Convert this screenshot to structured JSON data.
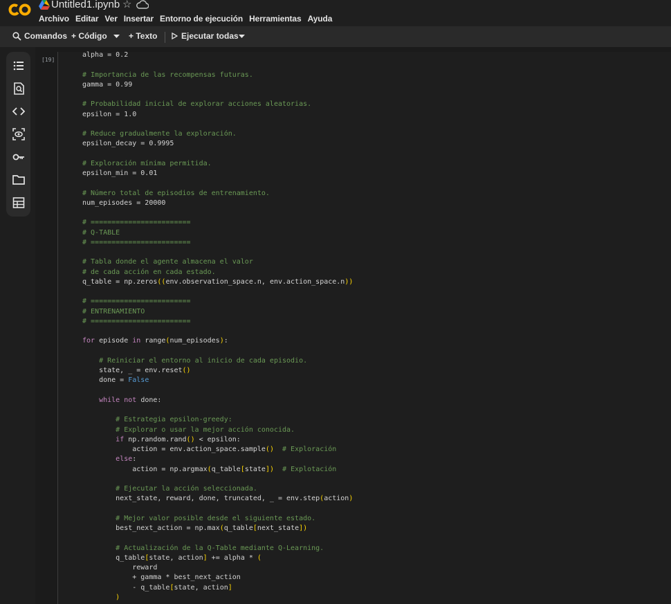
{
  "header": {
    "logo": "CO",
    "title": "Untitled1.ipynb",
    "star_icon": "star-icon",
    "cloud_icon": "cloud-icon"
  },
  "menu": [
    "Archivo",
    "Editar",
    "Ver",
    "Insertar",
    "Entorno de ejecución",
    "Herramientas",
    "Ayuda"
  ],
  "toolbar": {
    "commands": "Comandos",
    "code": "+ Código",
    "text": "+ Texto",
    "run_all": "Ejecutar todas"
  },
  "sidebar_icons": [
    "list-icon",
    "search-doc-icon",
    "code-icon",
    "variables-icon",
    "key-icon",
    "folder-icon",
    "table-icon"
  ],
  "cell": {
    "number": "[19]"
  },
  "colors": {
    "comment": "#6a9955",
    "keyword": "#c586c0",
    "bool": "#569cd6",
    "paren": "#ffd700"
  },
  "code_lines": [
    "alpha = 0.2",
    "",
    "# Importancia de las recompensas futuras.",
    "gamma = 0.99",
    "",
    "# Probabilidad inicial de explorar acciones aleatorias.",
    "epsilon = 1.0",
    "",
    "# Reduce gradualmente la exploración.",
    "epsilon_decay = 0.9995",
    "",
    "# Exploración mínima permitida.",
    "epsilon_min = 0.01",
    "",
    "# Número total de episodios de entrenamiento.",
    "num_episodes = 20000",
    "",
    "# ========================",
    "# Q-TABLE",
    "# ========================",
    "",
    "# Tabla donde el agente almacena el valor",
    "# de cada acción en cada estado.",
    "q_table = np.zeros((env.observation_space.n, env.action_space.n))",
    "",
    "# ========================",
    "# ENTRENAMIENTO",
    "# ========================",
    "",
    "for episode in range(num_episodes):",
    "",
    "    # Reiniciar el entorno al inicio de cada episodio.",
    "    state, _ = env.reset()",
    "    done = False",
    "",
    "    while not done:",
    "",
    "        # Estrategia epsilon-greedy:",
    "        # Explorar o usar la mejor acción conocida.",
    "        if np.random.rand() < epsilon:",
    "            action = env.action_space.sample()  # Exploración",
    "        else:",
    "            action = np.argmax(q_table[state])  # Explotación",
    "",
    "        # Ejecutar la acción seleccionada.",
    "        next_state, reward, done, truncated, _ = env.step(action)",
    "",
    "        # Mejor valor posible desde el siguiente estado.",
    "        best_next_action = np.max(q_table[next_state])",
    "",
    "        # Actualización de la Q-Table mediante Q-Learning.",
    "        q_table[state, action] += alpha * (",
    "            reward",
    "            + gamma * best_next_action",
    "            - q_table[state, action]",
    "        )"
  ]
}
